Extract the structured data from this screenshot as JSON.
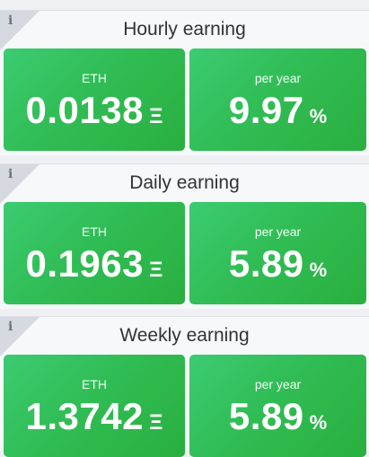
{
  "info_icon": "info-icon",
  "colors": {
    "card_green": "#31bf57",
    "panel_bg": "#f7f8fa",
    "title_text": "#333333"
  },
  "panels": [
    {
      "title": "Hourly earning",
      "eth": {
        "label": "ETH",
        "value": "0.0138",
        "unit": "Ξ"
      },
      "apy": {
        "label": "per year",
        "value": "9.97",
        "unit": "%"
      }
    },
    {
      "title": "Daily earning",
      "eth": {
        "label": "ETH",
        "value": "0.1963",
        "unit": "Ξ"
      },
      "apy": {
        "label": "per year",
        "value": "5.89",
        "unit": "%"
      }
    },
    {
      "title": "Weekly earning",
      "eth": {
        "label": "ETH",
        "value": "1.3742",
        "unit": "Ξ"
      },
      "apy": {
        "label": "per year",
        "value": "5.89",
        "unit": "%"
      }
    }
  ]
}
